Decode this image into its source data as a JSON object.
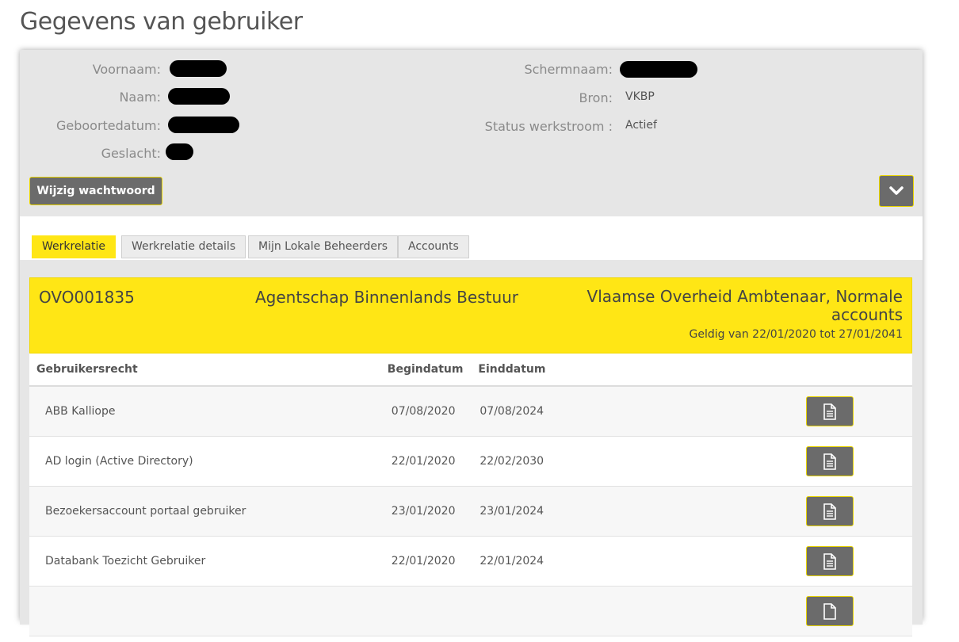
{
  "page": {
    "title": "Gegevens van gebruiker"
  },
  "profile": {
    "left": [
      {
        "label": "Voornaam:"
      },
      {
        "label": "Naam:"
      },
      {
        "label": "Geboortedatum:"
      },
      {
        "label": "Geslacht:"
      }
    ],
    "right": [
      {
        "label": "Schermnaam:"
      },
      {
        "label": "Bron:",
        "value": "VKBP"
      },
      {
        "label": "Status werkstroom :",
        "value": "Actief"
      }
    ],
    "change_password_label": "Wijzig wachtwoord",
    "toggle_icon": "chevron-down-icon"
  },
  "tabs": [
    {
      "label": "Werkrelatie",
      "active": true
    },
    {
      "label": "Werkrelatie details",
      "active": false
    },
    {
      "label": "Mijn Lokale Beheerders",
      "active": false
    },
    {
      "label": "Accounts",
      "active": false
    }
  ],
  "relation": {
    "code": "OVO001835",
    "organisation": "Agentschap Binnenlands Bestuur",
    "role": "Vlaamse Overheid Ambtenaar, Normale accounts",
    "validity": "Geldig van 22/01/2020 tot 27/01/2041"
  },
  "rights_table": {
    "columns": {
      "right": "Gebruikersrecht",
      "begin": "Begindatum",
      "end": "Einddatum"
    },
    "rows": [
      {
        "name": "ABB Kalliope",
        "begin": "07/08/2020",
        "end": "07/08/2024"
      },
      {
        "name": "AD login (Active Directory)",
        "begin": "22/01/2020",
        "end": "22/02/2030"
      },
      {
        "name": "Bezoekersaccount portaal gebruiker",
        "begin": "23/01/2020",
        "end": "23/01/2024"
      },
      {
        "name": "Databank Toezicht Gebruiker",
        "begin": "22/01/2020",
        "end": "22/01/2024"
      },
      {
        "name": "",
        "begin": "",
        "end": ""
      }
    ],
    "row_action_icon": "document-icon"
  },
  "colors": {
    "accent_yellow": "#ffe615",
    "button_gray": "#6b6b6b",
    "panel_gray": "#e6e6e6"
  }
}
